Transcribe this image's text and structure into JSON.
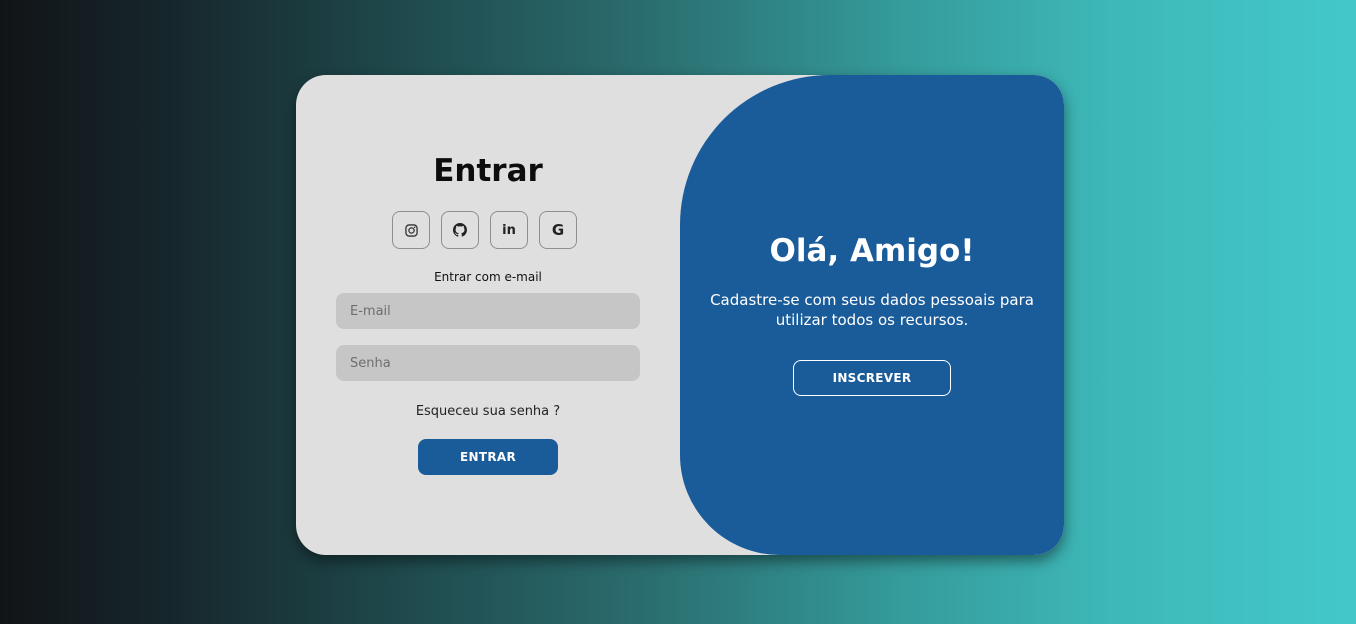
{
  "signin": {
    "title": "Entrar",
    "social": [
      {
        "icon": "instagram-icon"
      },
      {
        "icon": "github-icon"
      },
      {
        "icon": "linkedin-icon",
        "glyph": "in"
      },
      {
        "icon": "google-icon",
        "glyph": "G"
      }
    ],
    "alt_text": "Entrar com e-mail",
    "email_placeholder": "E-mail",
    "password_placeholder": "Senha",
    "forgot_link": "Esqueceu sua senha ?",
    "submit_label": "ENTRAR"
  },
  "panel": {
    "title": "Olá, Amigo!",
    "text": "Cadastre-se com seus dados pessoais para utilizar todos os recursos.",
    "button_label": "INSCREVER"
  },
  "colors": {
    "accent": "#1a5b9a",
    "card": "#dfdfdf",
    "input": "#c6c6c6"
  }
}
